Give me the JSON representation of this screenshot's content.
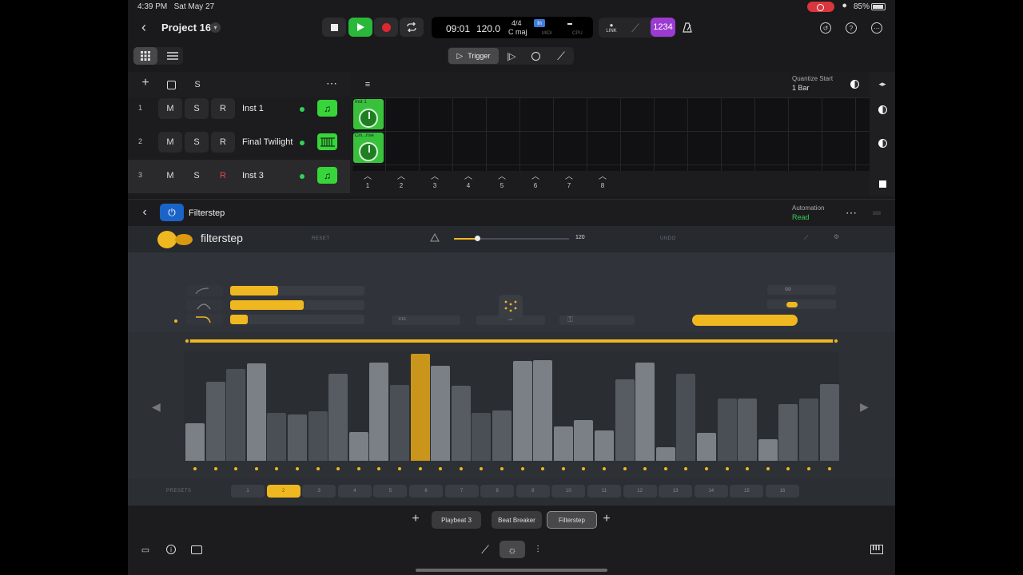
{
  "status": {
    "time": "4:39 PM",
    "date": "Sat May 27",
    "battery": "85%"
  },
  "header": {
    "project_title": "Project 16",
    "lcd": {
      "position": "09:01",
      "tempo": "120.0",
      "signature": "4/4",
      "key": "C maj",
      "in_badge": "In",
      "midi": "MIDI",
      "cpu": "CPU"
    },
    "link_label": "LINK",
    "count_in": "1234"
  },
  "modes": {
    "trigger_label": "Trigger"
  },
  "tracks": {
    "list_header_s": "S",
    "rows": [
      {
        "num": "1",
        "m": "M",
        "s": "S",
        "r": "R",
        "name": "Inst 1"
      },
      {
        "num": "2",
        "m": "M",
        "s": "S",
        "r": "R",
        "name": "Final Twilight"
      },
      {
        "num": "3",
        "m": "M",
        "s": "S",
        "r": "R",
        "name": "Inst 3"
      }
    ],
    "cells": [
      {
        "label": "Inst 1"
      },
      {
        "label": "Cin...nse"
      }
    ],
    "scenes": [
      "1",
      "2",
      "3",
      "4",
      "5",
      "6",
      "7",
      "8"
    ],
    "quantize_label": "Quantize Start",
    "quantize_value": "1 Bar"
  },
  "plugin_header": {
    "name": "Filterstep",
    "automation_label": "Automation",
    "automation_value": "Read"
  },
  "plugin": {
    "logo_text": "filterstep",
    "reset": "RESET",
    "undo": "UNDO",
    "tempo": "120",
    "tempo_level": 0.2,
    "shape_bars": [
      {
        "level": 0.36
      },
      {
        "level": 0.55
      },
      {
        "level": 0.13
      }
    ],
    "rate_value": "1/16",
    "steps_value": "32",
    "step_values": [
      0.35,
      0.74,
      0.86,
      0.91,
      0.45,
      0.43,
      0.46,
      0.81,
      0.27,
      0.92,
      0.71,
      1.0,
      0.89,
      0.7,
      0.45,
      0.47,
      0.93,
      0.94,
      0.32,
      0.38,
      0.28,
      0.76,
      0.92,
      0.13,
      0.81,
      0.26,
      0.58,
      0.58,
      0.2,
      0.53,
      0.58,
      0.72
    ],
    "active_step": 11,
    "presets_label": "PRESETS",
    "presets": [
      "1",
      "2",
      "3",
      "4",
      "5",
      "6",
      "7",
      "8",
      "9",
      "10",
      "11",
      "12",
      "13",
      "14",
      "15",
      "16"
    ],
    "active_preset": 1
  },
  "plugin_tabs": [
    "Playbeat 3",
    "Beat Breaker",
    "Filterstep"
  ],
  "colors": {
    "accent": "#f0b820",
    "green": "#37d53a",
    "purple": "#9c3bd1",
    "blue": "#1a64c8"
  }
}
